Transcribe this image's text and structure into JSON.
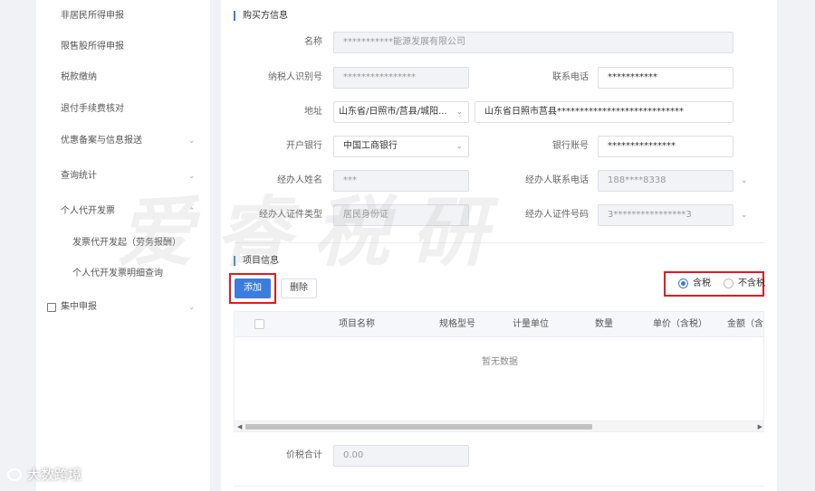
{
  "sidebar": {
    "items": [
      {
        "label": "非居民所得申报"
      },
      {
        "label": "限售股所得申报"
      },
      {
        "label": "税款缴纳"
      },
      {
        "label": "退付手续费核对"
      },
      {
        "label": "优惠备案与信息报送",
        "chevron": "⌄"
      },
      {
        "label": "查询统计",
        "chevron": "⌄"
      },
      {
        "label": "个人代开发票",
        "chevron": "⌃"
      },
      {
        "label": "发票代开发起（劳务报酬）"
      },
      {
        "label": "个人代开发票明细查询"
      },
      {
        "label": "集中申报",
        "chevron": "⌄"
      }
    ]
  },
  "buyer": {
    "title": "购买方信息",
    "name_label": "名称",
    "name_value": "***********能源发展有限公司",
    "tax_id_label": "纳税人识别号",
    "tax_id_value": "****************",
    "phone_label": "联系电话",
    "phone_value": "***********",
    "address_label": "地址",
    "address_select": "山东省/日照市/莒县/城阳...",
    "address_detail": "山东省日照市莒县****************************",
    "bank_label": "开户银行",
    "bank_value": "中国工商银行",
    "account_label": "银行账号",
    "account_value": "***************",
    "agent_name_label": "经办人姓名",
    "agent_name_value": "***",
    "agent_phone_label": "经办人联系电话",
    "agent_phone_value": "188****8338",
    "agent_idtype_label": "经办人证件类型",
    "agent_idtype_value": "居民身份证",
    "agent_idno_label": "经办人证件号码",
    "agent_idno_value": "3****************3"
  },
  "project": {
    "title": "项目信息",
    "add_label": "添加",
    "delete_label": "删除",
    "tax_included_label": "含税",
    "tax_excluded_label": "不含税",
    "selected_option": "含税",
    "columns": [
      "项目名称",
      "规格型号",
      "计量单位",
      "数量",
      "单价（含税）",
      "金额（含税）"
    ],
    "empty_text": "暂无数据",
    "total_label": "价税合计",
    "total_value": "0.00"
  },
  "icons": {
    "dropdown": "⌄",
    "scroll_left": "◀",
    "scroll_right": "▶"
  },
  "watermark": {
    "text": "爱睿税研"
  },
  "brand": {
    "text": "大数跨境"
  },
  "colors": {
    "accent": "#3b7ddd",
    "highlight": "#e8171f"
  }
}
